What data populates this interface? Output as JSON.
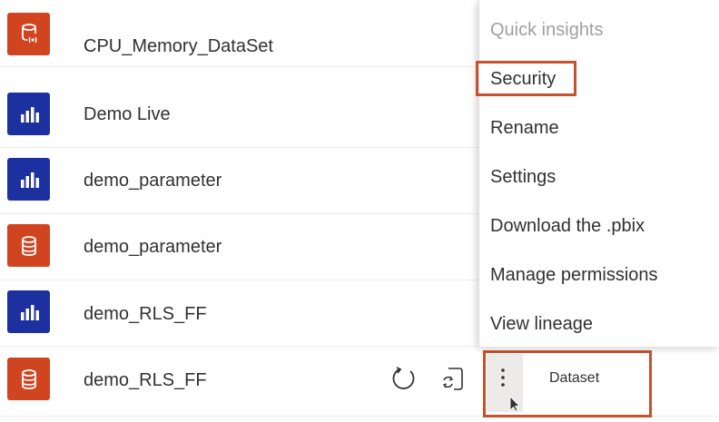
{
  "rows": [
    {
      "name": "CPU_Memory_DataSet",
      "icon": "streaming-dataset-icon",
      "color": "#d04420"
    },
    {
      "name": "Demo Live",
      "icon": "report-bar-chart-icon",
      "color": "#1d30a0"
    },
    {
      "name": "demo_parameter",
      "icon": "report-bar-chart-icon",
      "color": "#1d30a0"
    },
    {
      "name": "demo_parameter",
      "icon": "dataset-database-icon",
      "color": "#d04420"
    },
    {
      "name": "demo_RLS_FF",
      "icon": "report-bar-chart-icon",
      "color": "#1d30a0"
    },
    {
      "name": "demo_RLS_FF",
      "icon": "dataset-database-icon",
      "color": "#d04420"
    }
  ],
  "context_menu": {
    "items": [
      "Quick insights",
      "Security",
      "Rename",
      "Settings",
      "Download the .pbix",
      "Manage permissions",
      "View lineage"
    ]
  },
  "active_row": {
    "type_label": "Dataset",
    "refresh_icon": "refresh-icon",
    "schedule_refresh_icon": "schedule-refresh-icon",
    "more_icon": "more-options-icon"
  },
  "colors": {
    "highlight": "#c8502d",
    "dataset": "#d04420",
    "report": "#1d30a0"
  }
}
